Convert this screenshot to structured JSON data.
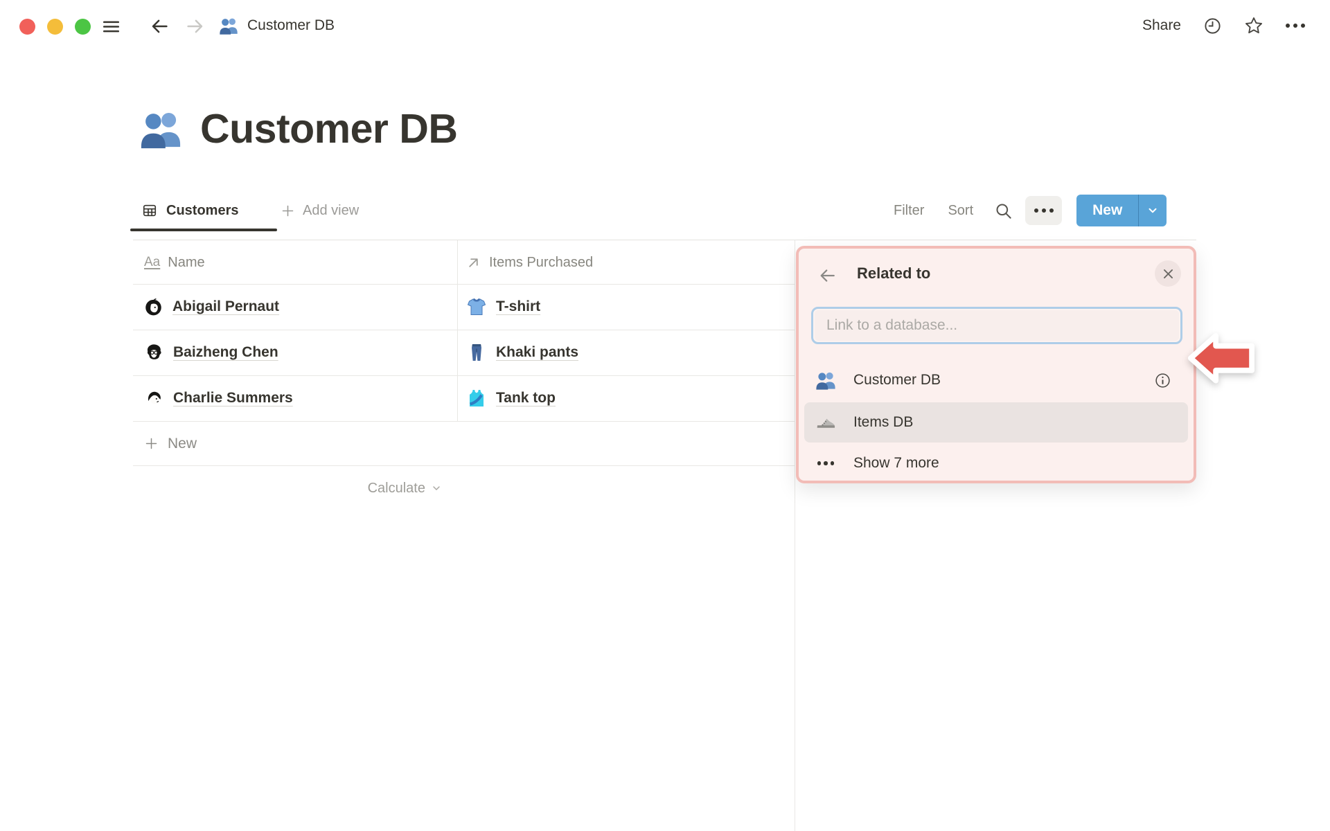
{
  "topbar": {
    "breadcrumb": "Customer DB",
    "share": "Share"
  },
  "page": {
    "title": "Customer DB"
  },
  "view_toolbar": {
    "active_tab": "Customers",
    "add_view": "Add view",
    "filter": "Filter",
    "sort": "Sort",
    "new_button": "New"
  },
  "table": {
    "columns": [
      {
        "label": "Name"
      },
      {
        "label": "Items Purchased"
      }
    ],
    "rows": [
      {
        "name": "Abigail Pernaut",
        "item": "T-shirt"
      },
      {
        "name": "Baizheng Chen",
        "item": "Khaki pants"
      },
      {
        "name": "Charlie Summers",
        "item": "Tank top"
      }
    ],
    "new_row": "New",
    "calculate": "Calculate"
  },
  "popup": {
    "title": "Related to",
    "placeholder": "Link to a database...",
    "items": [
      {
        "label": "Customer DB",
        "icon": "people-icon"
      },
      {
        "label": "Items DB",
        "icon": "sneaker-icon"
      },
      {
        "label": "Show 7 more",
        "icon": "ellipsis-icon"
      }
    ]
  },
  "colors": {
    "accent_blue": "#59a4d8",
    "annotation_bg": "#fcf0ee",
    "annotation_border": "#f2bcb7",
    "arrow_red": "#e2574f",
    "row_highlight": "#eae3e1",
    "focus_ring": "#aecde8"
  }
}
